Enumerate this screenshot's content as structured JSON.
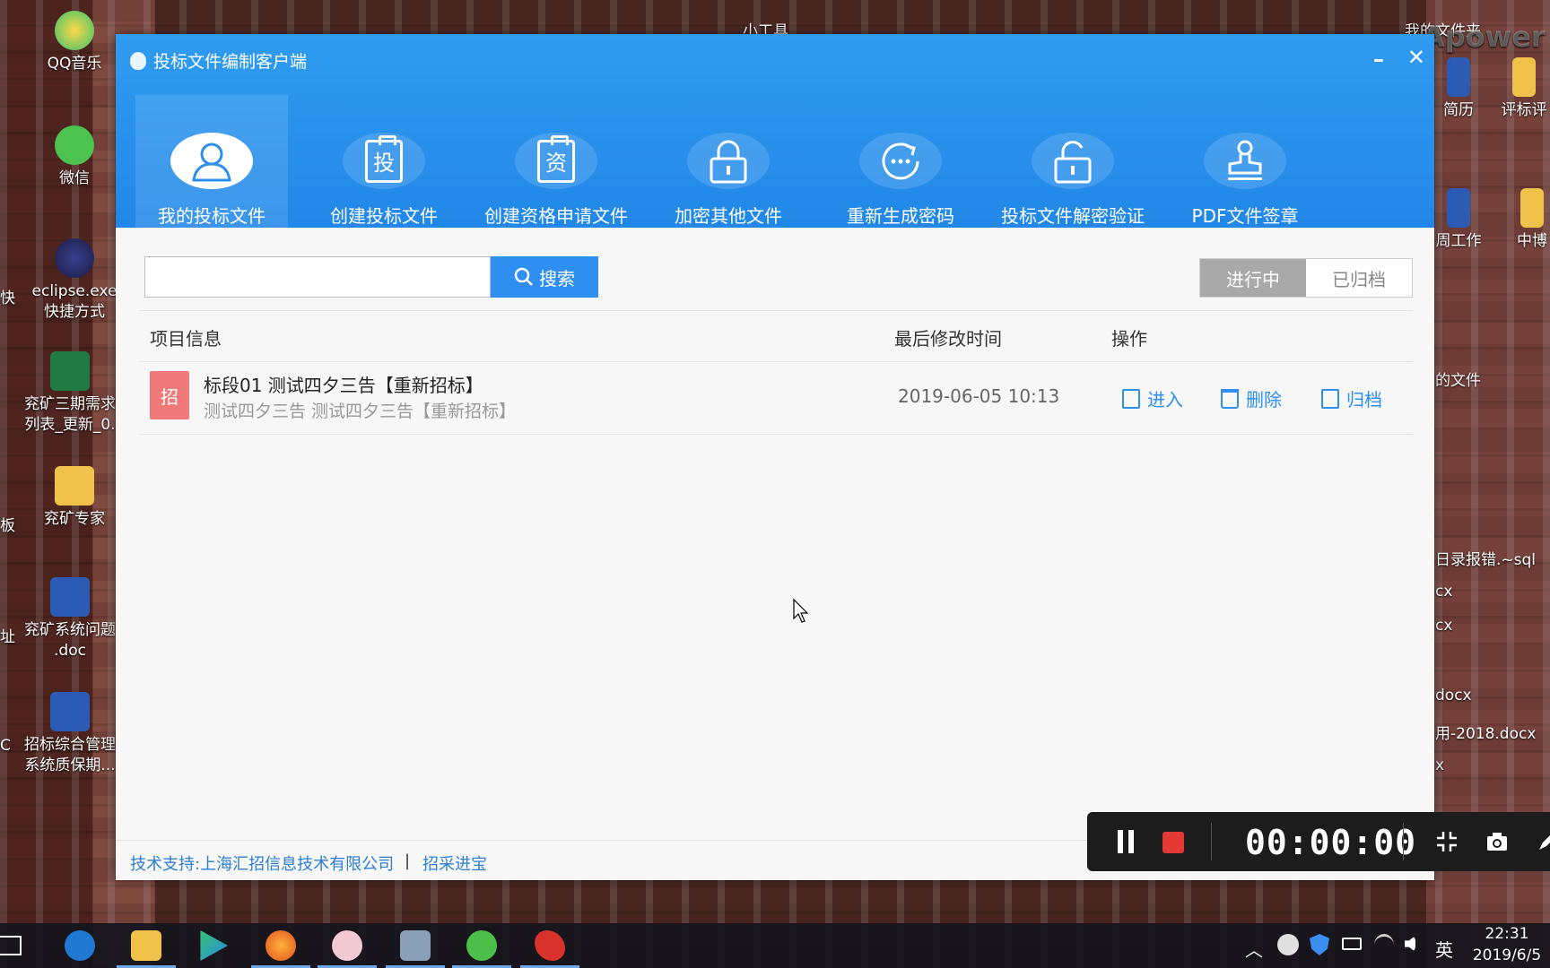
{
  "desktop": {
    "icons": [
      {
        "label": "QQ音乐"
      },
      {
        "label": "微信"
      },
      {
        "label": "eclipse.exe 快捷方式"
      },
      {
        "label": "兖矿三期需求 列表_更新_0."
      },
      {
        "label": "兖矿专家"
      },
      {
        "label": "兖矿系统问题 .doc"
      },
      {
        "label": "招标综合管理 系统质保期..."
      }
    ],
    "left_edge_fragments": [
      "快",
      "板",
      "址",
      "C"
    ],
    "right_icons": [
      {
        "label": "我的文件夹"
      },
      {
        "label": "简历"
      },
      {
        "label": "评标评"
      },
      {
        "label": "周工作"
      },
      {
        "label": "中博"
      }
    ],
    "right_text_fragments": [
      "的文件",
      "日录报错.~sql",
      "cx",
      "cx",
      "docx",
      "用-2018.docx",
      "x"
    ],
    "top_label": "小工具",
    "watermark": "Apower"
  },
  "window": {
    "title": "投标文件编制客户端",
    "minimize_symbol": "–",
    "close_symbol": "✕",
    "nav": [
      {
        "label": "我的投标文件",
        "active": true,
        "icon": "user-icon"
      },
      {
        "label": "创建投标文件",
        "active": false,
        "icon": "bid-clipboard-icon",
        "glyph": "投"
      },
      {
        "label": "创建资格申请文件",
        "active": false,
        "icon": "qualification-clipboard-icon",
        "glyph": "资"
      },
      {
        "label": "加密其他文件",
        "active": false,
        "icon": "lock-icon"
      },
      {
        "label": "重新生成密码",
        "active": false,
        "icon": "refresh-password-icon"
      },
      {
        "label": "投标文件解密验证",
        "active": false,
        "icon": "unlock-icon"
      },
      {
        "label": "PDF文件签章",
        "active": false,
        "icon": "stamp-icon"
      }
    ],
    "search": {
      "placeholder": "",
      "value": "",
      "button_label": "搜索"
    },
    "tabs": {
      "active": "进行中",
      "inactive": "已归档"
    },
    "table": {
      "headers": {
        "info": "项目信息",
        "time": "最后修改时间",
        "ops": "操作"
      },
      "rows": [
        {
          "badge": "招",
          "title": "标段01 测试四夕三告【重新招标】",
          "subtitle": "测试四夕三告 测试四夕三告【重新招标】",
          "modified": "2019-06-05 10:13",
          "actions": {
            "enter": "进入",
            "delete": "删除",
            "archive": "归档"
          }
        }
      ]
    },
    "footer": {
      "support": "技术支持:上海汇招信息技术有限公司",
      "divider": "|",
      "link": "招采进宝"
    }
  },
  "recorder": {
    "timer": "00:00:00"
  },
  "taskbar": {
    "tray": {
      "input_method": "英"
    },
    "clock": {
      "time": "22:31",
      "date": "2019/6/5"
    }
  },
  "colors": {
    "title_blue": "#2a92ee",
    "accent_blue": "#2e8ff0",
    "badge_red": "#f07a7a",
    "active_tab_gray": "#a9a9a9"
  }
}
